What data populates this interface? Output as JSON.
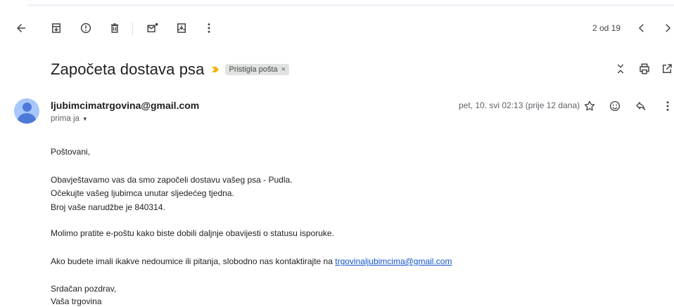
{
  "toolbar": {
    "pager": "2 od 19",
    "icons": [
      "back-arrow-icon",
      "archive-icon",
      "report-spam-icon",
      "delete-icon",
      "mark-unread-icon",
      "move-to-icon",
      "more-vert-icon",
      "older-icon",
      "newer-icon"
    ]
  },
  "email": {
    "subject": "Započeta dostava psa",
    "label": "Pristigla pošta",
    "label_remove": "×",
    "sender": "ljubimcimatrgovina@gmail.com",
    "recipient": "prima ja",
    "recipient_caret": "▼",
    "date": "pet, 10. svi 02:13 (prije 12 dana)",
    "body": {
      "greeting": "Poštovani,",
      "line1": "Obavještavamo vas da smo započeli dostavu vašeg psa - Pudla.",
      "line2": "Očekujte vašeg ljubimca unutar sljedećeg tjedna.",
      "line3": "Broj vaše narudžbe je 840314.",
      "line4": "Molimo pratite e-poštu kako biste dobili daljnje obavijesti o statusu isporuke.",
      "line5_prefix": "Ako budete imali ikakve nedoumice ili pitanja, slobodno nas kontaktirajte na ",
      "line5_link": "trgovinaljubimcima@gmail.com",
      "closing": "Srdačan pozdrav,",
      "signature": "Vaša trgovina"
    }
  },
  "colors": {
    "importance": "#f4b400",
    "link": "#1155cc",
    "avatar_bg": "#a8c7fa",
    "avatar_fg": "#4d7ad9"
  }
}
